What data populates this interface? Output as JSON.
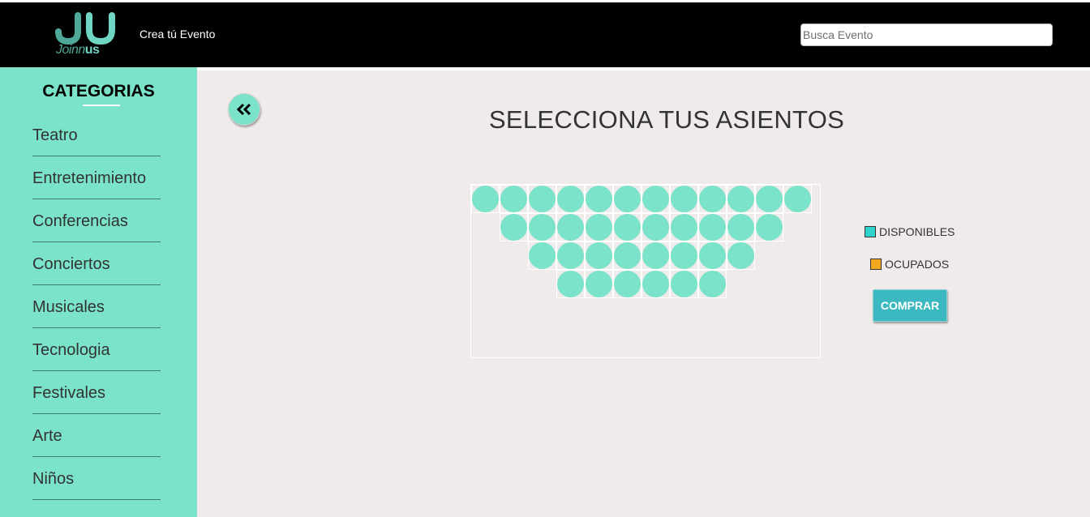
{
  "header": {
    "logo_text_light": "Joinn",
    "logo_text_bold": "us",
    "create_event_label": "Crea tú Evento",
    "search_placeholder": "Busca Evento"
  },
  "sidebar": {
    "title": "CATEGORIAS",
    "items": [
      "Teatro",
      "Entretenimiento",
      "Conferencias",
      "Conciertos",
      "Musicales",
      "Tecnologia",
      "Festivales",
      "Arte",
      "Niños"
    ]
  },
  "main": {
    "back_icon": "double-chevron-left-icon",
    "title": "SELECCIONA TUS ASIENTOS",
    "seat_rows": [
      {
        "offset": 0,
        "count": 12,
        "status": "available"
      },
      {
        "offset": 1,
        "count": 10,
        "status": "available"
      },
      {
        "offset": 2,
        "count": 8,
        "status": "available"
      },
      {
        "offset": 3,
        "count": 6,
        "status": "available"
      }
    ],
    "legend": {
      "available_label": "DISPONIBLES",
      "available_color": "#2ed3cc",
      "occupied_label": "OCUPADOS",
      "occupied_color": "#f3a71a"
    },
    "buy_label": "COMPRAR"
  },
  "colors": {
    "seat_available": "#7ae3ca",
    "sidebar": "#7ae3ca",
    "header": "#000000",
    "button": "#3cb8c0"
  }
}
